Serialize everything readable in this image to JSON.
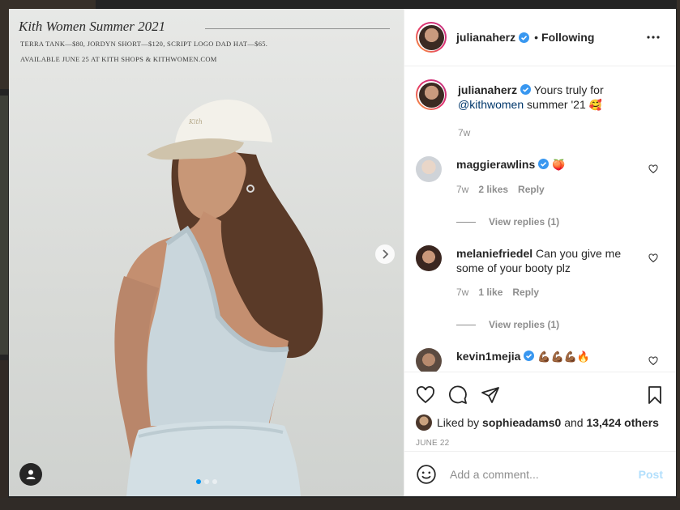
{
  "photo": {
    "collection_title": "Kith Women Summer 2021",
    "line1": "TERRA TANK—$80, JORDYN SHORT—$120, SCRIPT LOGO DAD HAT—$65.",
    "line2": "AVAILABLE JUNE 25 AT KITH SHOPS & KITHWOMEN.COM",
    "cap_script": "Kith",
    "slide_index": 1,
    "slide_count": 3
  },
  "header": {
    "username": "julianaherz",
    "separator": "•",
    "follow_status": "Following"
  },
  "caption": {
    "username": "julianaherz",
    "text": "Yours truly for",
    "mention": "@kithwomen",
    "text_after": "summer '21",
    "emoji": "🥰",
    "time": "7w"
  },
  "comments": [
    {
      "username": "maggierawlins",
      "text": "",
      "emoji": "🍑",
      "time": "7w",
      "likes": "2 likes",
      "reply": "Reply",
      "view_replies": "View replies (1)"
    },
    {
      "username": "melaniefriedel",
      "text": "Can you give me some of your booty plz",
      "emoji": "",
      "time": "7w",
      "likes": "1 like",
      "reply": "Reply",
      "view_replies": "View replies (1)"
    },
    {
      "username": "kevin1mejia",
      "text": "",
      "emoji": "💪🏾💪🏾💪🏾🔥"
    }
  ],
  "likes": {
    "prefix": "Liked by",
    "user": "sophieadams0",
    "conj": "and",
    "count": "13,424 others"
  },
  "post_date": "JUNE 22",
  "comment_box": {
    "placeholder": "Add a comment...",
    "post_label": "Post"
  },
  "colors": {
    "link": "#00376b",
    "verified": "#3897f0",
    "post_disabled": "#b2dffc",
    "active_dot": "#0095f6"
  },
  "icons": [
    "heart-icon",
    "comment-icon",
    "share-icon",
    "bookmark-icon",
    "more-icon",
    "chevron-right-icon",
    "user-tag-icon",
    "smiley-icon",
    "verified-icon"
  ]
}
